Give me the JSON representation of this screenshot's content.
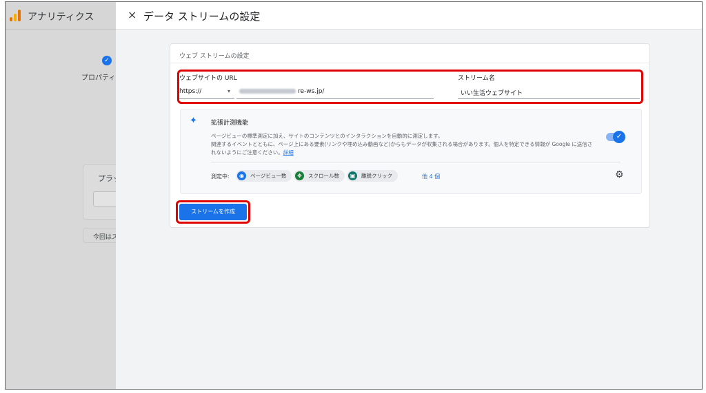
{
  "app": {
    "title": "アナリティクス"
  },
  "background": {
    "step_icon": "✓",
    "step_label": "プロパティ(",
    "card_label": "プラッ",
    "button_label": "今回はス"
  },
  "dialog": {
    "close_icon": "×",
    "title": "データ ストリームの設定",
    "card_title": "ウェブ ストリームの設定",
    "url": {
      "label": "ウェブサイトの URL",
      "protocol_value": "https://",
      "protocol_caret": "▾",
      "domain_suffix": "re-ws.jp/"
    },
    "stream_name": {
      "label": "ストリーム名",
      "value": "いい生活ウェブサイト"
    },
    "enhanced": {
      "title": "拡張計測機能",
      "desc_line1": "ページビューの標準測定に加え、サイトのコンテンツとのインタラクションを自動的に測定します。",
      "desc_line2": "関連するイベントとともに、ページ上にある要素(リンクや埋め込み動画など)からもデータが収集される場合があります。個人を特定できる情報が Google に送信さ",
      "desc_line3": "れないようにご注意ください。",
      "detail_link": "詳細",
      "toggle_icon": "✓",
      "measuring_label": "測定中:",
      "chips": [
        {
          "icon": "eye-icon",
          "glyph": "◉",
          "color": "#1a73e8",
          "label": "ページビュー数"
        },
        {
          "icon": "scroll-icon",
          "glyph": "✥",
          "color": "#188038",
          "label": "スクロール数"
        },
        {
          "icon": "mouse-icon",
          "glyph": "▣",
          "color": "#12796f",
          "label": "離脱クリック"
        }
      ],
      "more_label": "他 4 個",
      "gear_icon": "⚙"
    },
    "create_button": "ストリームを作成"
  },
  "highlight_color": "#e00000",
  "accent_color": "#1a73e8"
}
